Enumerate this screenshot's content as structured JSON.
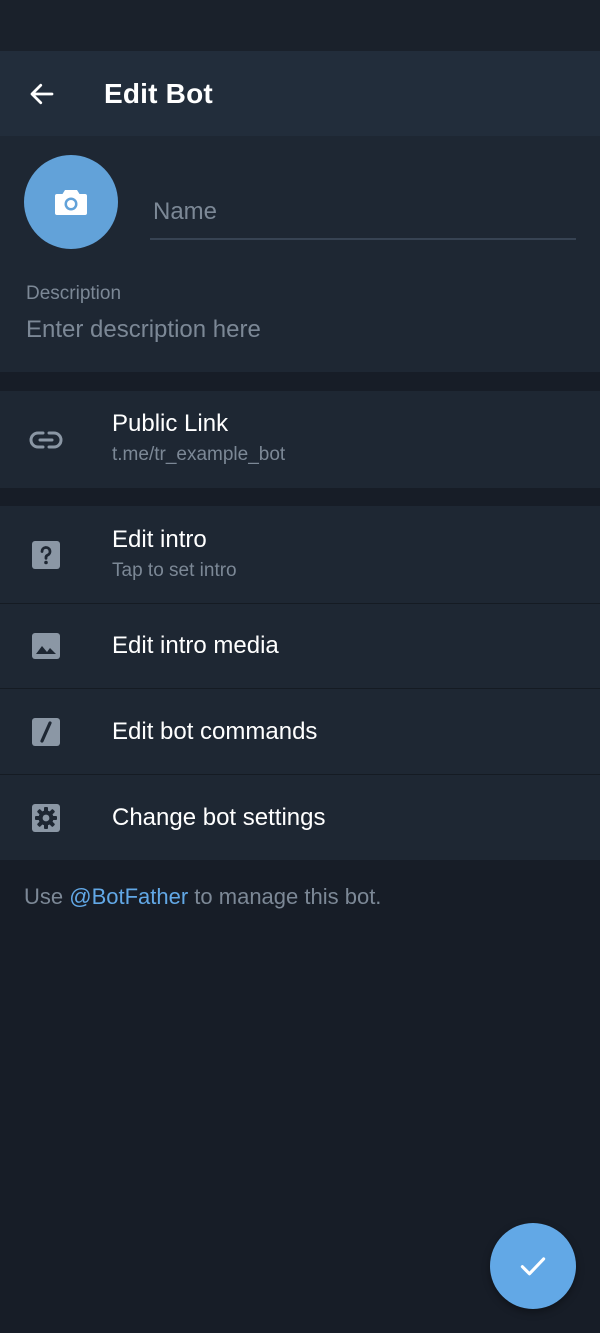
{
  "app_bar": {
    "title": "Edit Bot"
  },
  "profile": {
    "name_placeholder": "Name",
    "description_label": "Description",
    "description_placeholder": "Enter description here"
  },
  "public_link": {
    "title": "Public Link",
    "value": "t.me/tr_example_bot"
  },
  "settings": {
    "edit_intro": {
      "title": "Edit intro",
      "subtitle": "Tap to set intro"
    },
    "edit_intro_media": {
      "title": "Edit intro media"
    },
    "edit_bot_commands": {
      "title": "Edit bot commands"
    },
    "change_bot_settings": {
      "title": "Change bot settings"
    }
  },
  "footer": {
    "prefix": "Use ",
    "mention": "@BotFather",
    "suffix": " to manage this bot."
  },
  "colors": {
    "accent": "#62a8e6",
    "background": "#171d27",
    "card": "#1e2733",
    "header": "#222d3b",
    "secondary_text": "#7c8896"
  },
  "icons": {
    "back": "arrow-left-icon",
    "avatar": "camera-icon",
    "link": "link-icon",
    "intro": "help-icon",
    "media": "image-icon",
    "commands": "slash-icon",
    "settings": "gear-icon",
    "fab": "check-icon"
  }
}
